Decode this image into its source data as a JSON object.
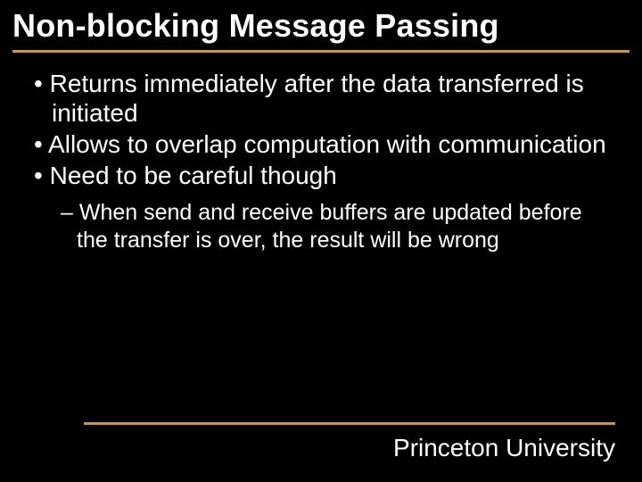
{
  "title": "Non-blocking Message Passing",
  "bullets": [
    "Returns immediately after the data transferred is initiated",
    "Allows to overlap computation with communication",
    "Need to be careful though"
  ],
  "sub_bullets": [
    "When send and receive buffers are updated before the transfer is over, the result will be wrong"
  ],
  "footer": "Princeton University",
  "accent_color": "#cc9933"
}
